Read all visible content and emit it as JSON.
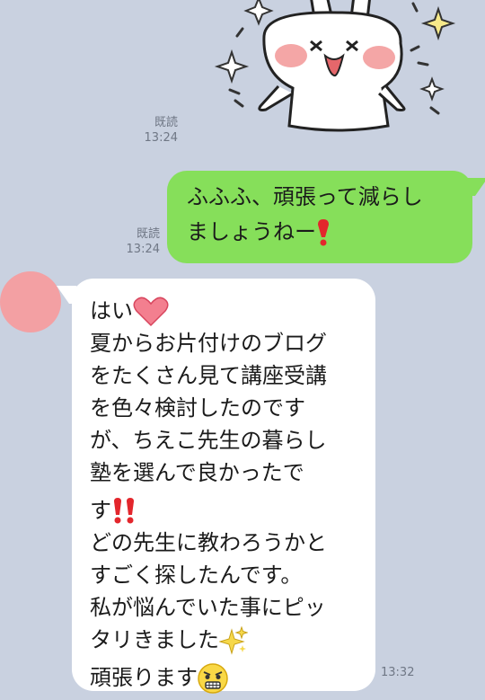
{
  "sticker": {
    "name": "bunny-sticker"
  },
  "outgoing": {
    "read_label": "既読",
    "time": "13:24",
    "lines": [
      "ふふふ、頑張って減らし",
      "ましょうねー"
    ],
    "emoji": "heavy-exclamation-mark-icon"
  },
  "sticker_meta": {
    "read_label": "既読",
    "time": "13:24"
  },
  "incoming": {
    "time": "13:32",
    "lines": [
      "はい",
      "夏からお片付けのブログ",
      "をたくさん見て講座受講",
      "を色々検討したのです",
      "が、ちえこ先生の暮らし",
      "塾を選んで良かったで",
      "す",
      "どの先生に教わろうかと",
      "すごく探したんです。",
      "私が悩んでいた事にピッ",
      "タリきました",
      "頑張ります"
    ]
  },
  "colors": {
    "background": "#c9d1e0",
    "outgoing_bubble": "#86df5a",
    "incoming_bubble": "#ffffff",
    "avatar": "#f3a0a3"
  }
}
